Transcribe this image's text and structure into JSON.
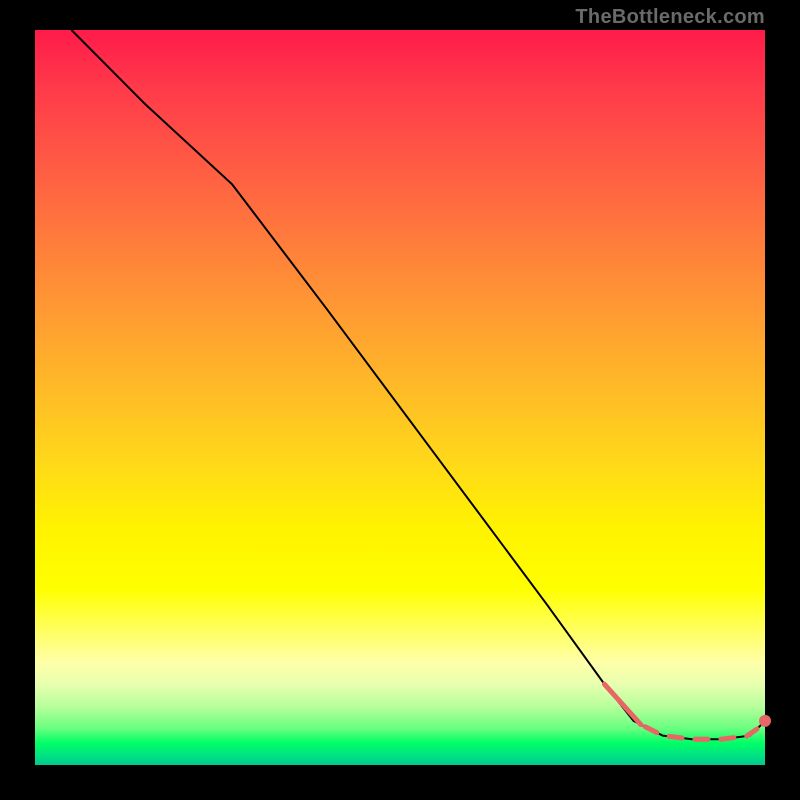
{
  "watermark": "TheBottleneck.com",
  "chart_data": {
    "type": "line",
    "title": "",
    "xlabel": "",
    "ylabel": "",
    "xlim": [
      0,
      100
    ],
    "ylim": [
      0,
      100
    ],
    "grid": false,
    "legend": false,
    "series": [
      {
        "name": "curve",
        "style": "solid-black",
        "x": [
          5,
          15,
          27,
          40,
          55,
          70,
          78,
          82,
          86,
          90,
          94,
          98,
          100
        ],
        "y": [
          100,
          90,
          79,
          62,
          42,
          22,
          11,
          6,
          4,
          3.5,
          3.5,
          4,
          6
        ]
      },
      {
        "name": "marker-segments",
        "style": "dashed-salmon",
        "x": [
          78,
          82,
          86,
          90,
          94,
          98,
          100
        ],
        "y": [
          11,
          6,
          4,
          3.5,
          3.5,
          4,
          6
        ]
      }
    ],
    "annotations": [
      {
        "type": "point",
        "x": 100,
        "y": 6,
        "color": "#e86666"
      }
    ]
  }
}
